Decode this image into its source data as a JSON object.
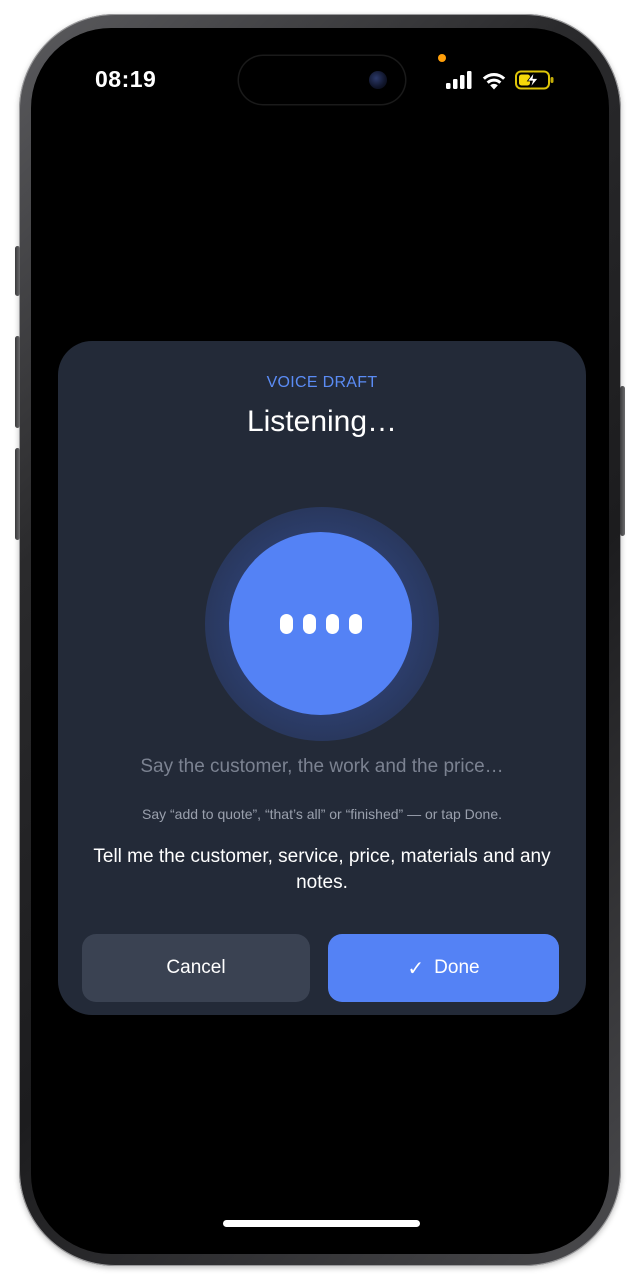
{
  "status_bar": {
    "time": "08:19",
    "icons": [
      "cellular-signal-icon",
      "wifi-icon",
      "battery-charging-icon"
    ],
    "privacy_indicator_color": "#ff9f0a",
    "battery_color": "#f5d90a"
  },
  "voice_sheet": {
    "eyebrow": "VOICE DRAFT",
    "title": "Listening…",
    "prompt": "Say the customer, the work and the price…",
    "hint": "Say “add to quote”, “that’s all” or “finished” — or tap Done.",
    "instruction": "Tell me the customer, service, price, materials and any notes.",
    "cancel_label": "Cancel",
    "done_label": "Done",
    "done_icon": "checkmark-icon",
    "mic_indicator_icon": "listening-dots-icon"
  },
  "colors": {
    "accent": "#5482f5",
    "sheet_background": "#232a38",
    "cancel_background": "#3a4252",
    "eyebrow": "#5b8cf5"
  }
}
